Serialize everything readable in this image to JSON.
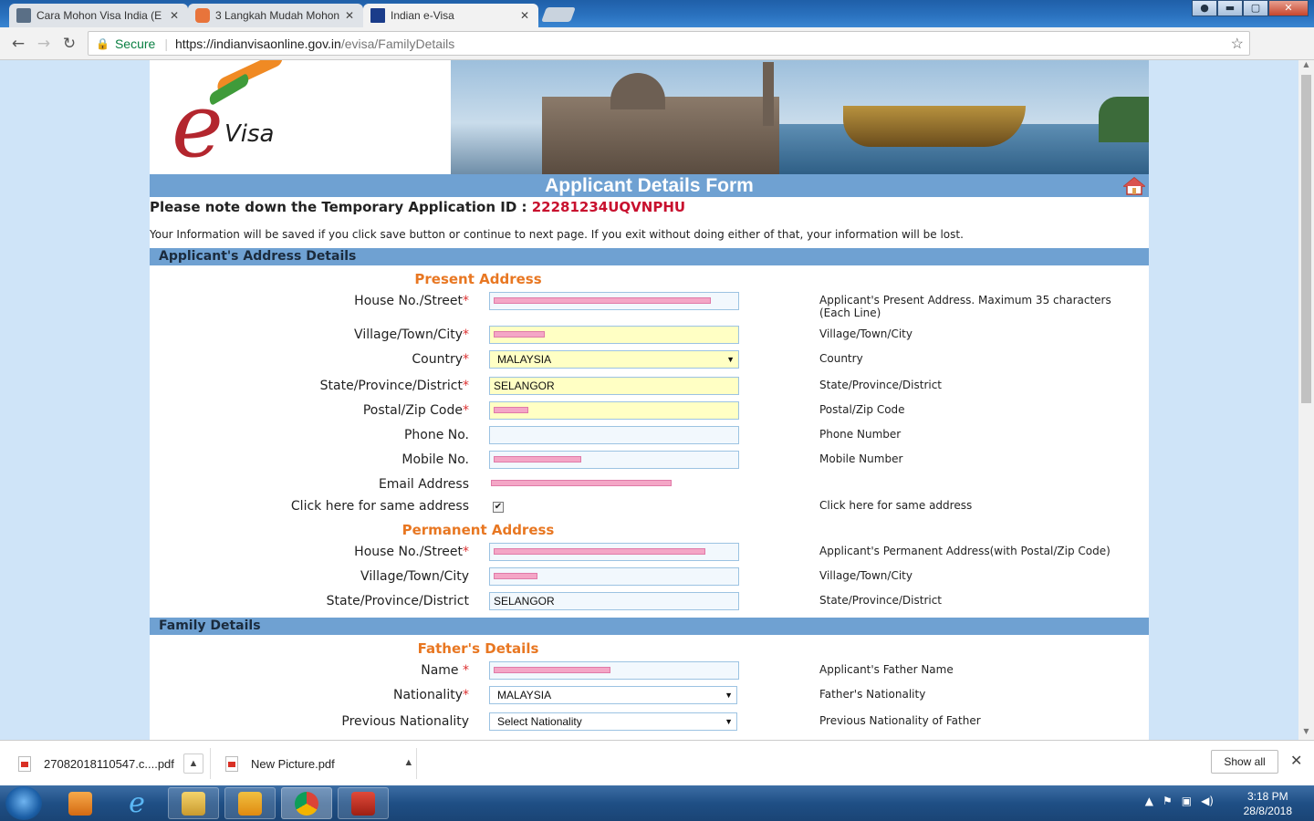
{
  "browser": {
    "tabs": [
      {
        "title": "Cara Mohon Visa India (E",
        "favicon": "image-icon",
        "active": false
      },
      {
        "title": "3 Langkah Mudah Mohon",
        "favicon": "blogger-icon",
        "active": false
      },
      {
        "title": "Indian e-Visa",
        "favicon": "nic-icon",
        "active": true
      }
    ],
    "close_glyph": "✕",
    "secure_label": "Secure",
    "url_host": "https://indianvisaonline.gov.in",
    "url_path": "/evisa/FamilyDetails",
    "window_buttons": {
      "minimize": "▬",
      "maximize": "▢",
      "close": "✕"
    }
  },
  "logo": {
    "e": "e",
    "visa": "Visa"
  },
  "form": {
    "title": "Applicant Details Form",
    "app_id_label": "Please note down the Temporary Application ID :",
    "app_id_value": "22281234UQVNPHU",
    "notice": "Your Information will be saved if you click save button or continue to next page. If you exit without doing either of that, your information will be lost."
  },
  "address_section": {
    "title": "Applicant's Address Details",
    "present_heading": "Present Address",
    "present": [
      {
        "label": "House No./Street",
        "required": true,
        "value": "",
        "help": "Applicant's Present Address. Maximum 35 characters (Each Line)"
      },
      {
        "label": "Village/Town/City",
        "required": true,
        "value": "",
        "help": "Village/Town/City"
      },
      {
        "label": "Country",
        "required": true,
        "value": "MALAYSIA",
        "help": "Country"
      },
      {
        "label": "State/Province/District",
        "required": true,
        "value": "SELANGOR",
        "help": "State/Province/District"
      },
      {
        "label": "Postal/Zip Code",
        "required": true,
        "value": "",
        "help": "Postal/Zip Code"
      },
      {
        "label": "Phone No.",
        "required": false,
        "value": "",
        "help": "Phone Number"
      },
      {
        "label": "Mobile No.",
        "required": false,
        "value": "",
        "help": "Mobile Number"
      },
      {
        "label": "Email Address",
        "required": false,
        "value": "",
        "help": ""
      },
      {
        "label": "Click here for same address",
        "required": false,
        "checked": true,
        "help": "Click here for same address"
      }
    ],
    "permanent_heading": "Permanent Address",
    "permanent": [
      {
        "label": "House No./Street",
        "required": true,
        "value": "",
        "help": "Applicant's Permanent Address(with Postal/Zip Code)"
      },
      {
        "label": "Village/Town/City",
        "required": false,
        "value": "",
        "help": "Village/Town/City"
      },
      {
        "label": "State/Province/District",
        "required": false,
        "value": "SELANGOR",
        "help": "State/Province/District"
      }
    ]
  },
  "family_section": {
    "title": "Family Details",
    "father_heading": "Father's Details",
    "father": [
      {
        "label": "Name ",
        "required": true,
        "value": "",
        "help": "Applicant's Father Name"
      },
      {
        "label": "Nationality",
        "required": true,
        "value": "MALAYSIA",
        "help": "Father's Nationality"
      },
      {
        "label": "Previous Nationality",
        "required": false,
        "value": "Select Nationality",
        "help": "Previous Nationality of Father"
      }
    ]
  },
  "required_marker": "*",
  "checkmark": "✔",
  "downloads": {
    "items": [
      {
        "name": "27082018110547.c....pdf"
      },
      {
        "name": "New Picture.pdf"
      }
    ],
    "show_all": "Show all",
    "close": "✕"
  },
  "taskbar": {
    "time": "3:18 PM",
    "date": "28/8/2018"
  },
  "colors": {
    "section_bar": "#6fa1d2",
    "subheading": "#e87722",
    "app_id": "#c8102e",
    "input_yellow": "#ffffc4",
    "redaction": "#f4a6c6"
  }
}
